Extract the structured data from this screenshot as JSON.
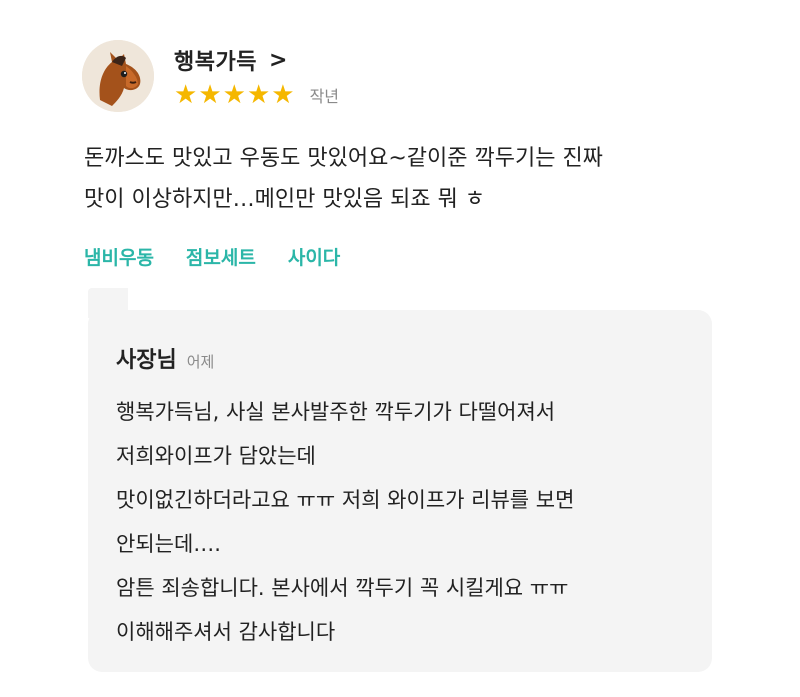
{
  "review": {
    "avatar_icon": "horse-avatar-icon",
    "reviewer_name": "행복가득",
    "chevron": ">",
    "rating": 5,
    "star_glyph": "★",
    "star_color": "#f5b700",
    "date": "작년",
    "body_lines": [
      "돈까스도 맛있고 우동도 맛있어요~같이준 깍두기는 진짜",
      "맛이 이상하지만…메인만 맛있음 되죠 뭐 ㅎ"
    ],
    "tags": [
      "냄비우동",
      "점보세트",
      "사이다"
    ],
    "tag_color": "#2bb6a8"
  },
  "reply": {
    "author": "사장님",
    "date": "어제",
    "body_lines": [
      "행복가득님, 사실 본사발주한 깍두기가 다떨어져서",
      "저희와이프가 담았는데",
      "맛이없긴하더라고요 ㅠㅠ 저희 와이프가 리뷰를 보면",
      "안되는데….",
      "암튼 죄송합니다. 본사에서 깍두기 꼭 시킬게요 ㅠㅠ",
      "이해해주셔서 감사합니다"
    ],
    "background": "#f4f4f4"
  }
}
